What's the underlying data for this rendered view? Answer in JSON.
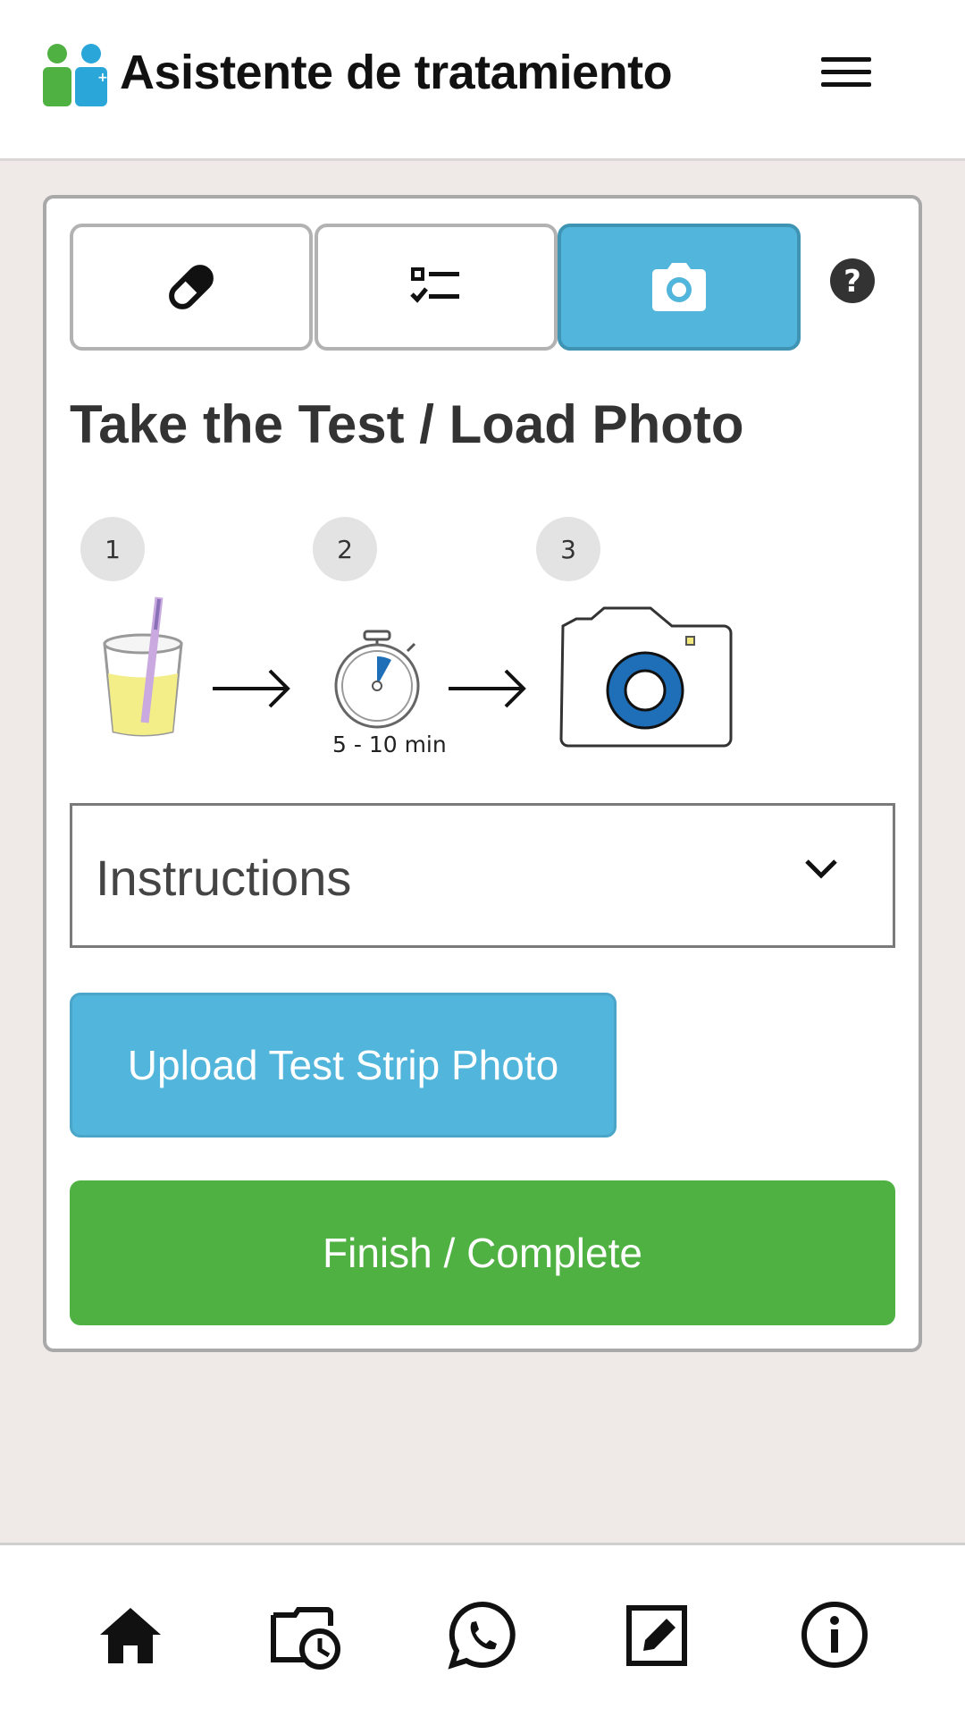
{
  "header": {
    "title": "Asistente de tratamiento",
    "logo_icon": "people-plus-logo",
    "menu_icon": "hamburger-menu-icon"
  },
  "tabs": [
    {
      "icon": "pill-icon",
      "active": false
    },
    {
      "icon": "checklist-icon",
      "active": false
    },
    {
      "icon": "camera-icon",
      "active": true
    }
  ],
  "help_icon": "question-circle-icon",
  "section": {
    "title": "Take the Test / Load Photo"
  },
  "steps": {
    "numbers": [
      "1",
      "2",
      "3"
    ],
    "timer_label": "5 - 10 min"
  },
  "instructions": {
    "label": "Instructions",
    "expanded": false
  },
  "buttons": {
    "upload_label": "Upload Test Strip Photo",
    "finish_label": "Finish / Complete"
  },
  "bottom_nav": [
    {
      "icon": "home-icon"
    },
    {
      "icon": "calendar-clock-icon"
    },
    {
      "icon": "whatsapp-icon"
    },
    {
      "icon": "edit-icon"
    },
    {
      "icon": "info-icon"
    }
  ],
  "colors": {
    "accent_blue": "#52b5db",
    "success_green": "#4fb142",
    "background": "#efe9e8"
  }
}
